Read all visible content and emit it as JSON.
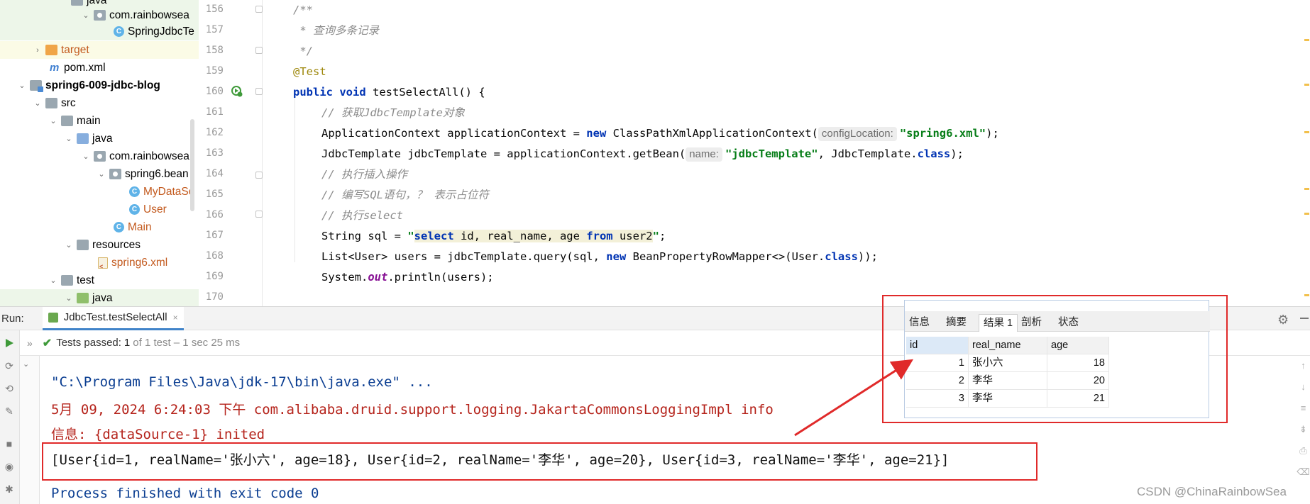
{
  "project_tree": {
    "items": [
      {
        "label": "java",
        "icon": "folder-icon"
      },
      {
        "label": "com.rainbowsea",
        "icon": "package-icon"
      },
      {
        "label": "SpringJdbcTe",
        "icon": "class-icon",
        "badge": "C"
      },
      {
        "label": "target",
        "icon": "folder-orange-icon"
      },
      {
        "label": "pom.xml",
        "icon": "maven-icon",
        "badge": "m"
      },
      {
        "label": "spring6-009-jdbc-blog",
        "icon": "module-icon"
      },
      {
        "label": "src",
        "icon": "folder-icon"
      },
      {
        "label": "main",
        "icon": "folder-icon"
      },
      {
        "label": "java",
        "icon": "folder-blue-icon"
      },
      {
        "label": "com.rainbowsea",
        "icon": "package-icon"
      },
      {
        "label": "spring6.bean",
        "icon": "package-icon"
      },
      {
        "label": "MyDataSo",
        "icon": "class-icon",
        "badge": "C"
      },
      {
        "label": "User",
        "icon": "class-icon",
        "badge": "C"
      },
      {
        "label": "Main",
        "icon": "class-icon",
        "badge": "C"
      },
      {
        "label": "resources",
        "icon": "folder-icon"
      },
      {
        "label": "spring6.xml",
        "icon": "xml-icon"
      },
      {
        "label": "test",
        "icon": "folder-icon"
      },
      {
        "label": "java",
        "icon": "folder-green-icon"
      }
    ]
  },
  "editor": {
    "line_numbers": [
      "156",
      "157",
      "158",
      "159",
      "160",
      "161",
      "162",
      "163",
      "164",
      "165",
      "166",
      "167",
      "168",
      "169",
      "170"
    ],
    "code": {
      "l156": "/**",
      "l157": " * 查询多条记录",
      "l158": " */",
      "l159": "@Test",
      "l160_kw1": "public",
      "l160_kw2": "void",
      "l160_rest": "testSelectAll() {",
      "l161": "// 获取JdbcTemplate对象",
      "l162_a": "ApplicationContext applicationContext = ",
      "l162_kw": "new",
      "l162_b": " ClassPathXmlApplicationContext(",
      "l162_hint": "configLocation:",
      "l162_str": "\"spring6.xml\"",
      "l162_c": ");",
      "l163_a": "JdbcTemplate jdbcTemplate = applicationContext.getBean(",
      "l163_hint": "name:",
      "l163_str": "\"jdbcTemplate\"",
      "l163_b": ", JdbcTemplate.",
      "l163_kw": "class",
      "l163_c": ");",
      "l164": "// 执行插入操作",
      "l165": "// 编写SQL语句，？ 表示占位符",
      "l166": "// 执行select",
      "l167_a": "String sql = ",
      "l167_q1": "\"",
      "l167_select": "select",
      "l167_mid": " id, real_name, age ",
      "l167_from": "from",
      "l167_tbl": " user2",
      "l167_q2": "\"",
      "l167_end": ";",
      "l168_a": "List<User> users = jdbcTemplate.query(sql, ",
      "l168_kw": "new",
      "l168_b": " BeanPropertyRowMapper<>(User.",
      "l168_kw2": "class",
      "l168_c": "));",
      "l169_a": "System.",
      "l169_out": "out",
      "l169_b": ".println(users);"
    }
  },
  "run_window": {
    "label": "Run:",
    "tab": "JdbcTest.testSelectAll",
    "tab_close": "×",
    "status": {
      "prefix": "Tests passed:",
      "count": "1",
      "detail": "of 1 test – 1 sec 25 ms"
    },
    "console": {
      "line1": "\"C:\\Program Files\\Java\\jdk-17\\bin\\java.exe\" ...",
      "line2": "5月 09, 2024 6:24:03 下午 com.alibaba.druid.support.logging.JakartaCommonsLoggingImpl info",
      "line3": "信息: {dataSource-1} inited",
      "line4": "[User{id=1, realName='张小六', age=18}, User{id=2, realName='李华', age=20}, User{id=3, realName='李华', age=21}]",
      "line5": "Process finished with exit code 0"
    }
  },
  "db_result": {
    "tabs": [
      "信息",
      "摘要",
      "结果 1",
      "剖析",
      "状态"
    ],
    "active_tab": "结果 1",
    "columns": [
      "id",
      "real_name",
      "age"
    ],
    "rows": [
      {
        "id": "1",
        "real_name": "张小六",
        "age": "18"
      },
      {
        "id": "2",
        "real_name": "李华",
        "age": "20"
      },
      {
        "id": "3",
        "real_name": "李华",
        "age": "21"
      }
    ]
  },
  "watermark": "CSDN @ChinaRainbowSea",
  "colors": {
    "highlight_red": "#e02a2a",
    "keyword": "#0033b3",
    "string": "#067d17",
    "comment": "#8c8c8c",
    "annotation": "#9e880d",
    "console_error": "#b5231b",
    "console_info": "#0a3d91"
  }
}
